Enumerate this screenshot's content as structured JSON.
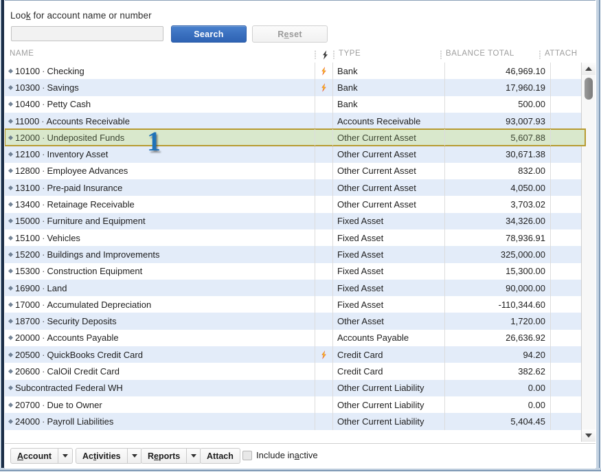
{
  "search": {
    "label_prefix": "Loo",
    "label_accel": "k",
    "label_suffix": " for account name or number",
    "label_full": "Look for account name or number",
    "input_value": "",
    "input_placeholder": "",
    "search_button": "Search",
    "reset_button": "Reset",
    "search_button_color": "#3a70bf"
  },
  "table": {
    "columns": [
      {
        "key": "name",
        "label": "NAME"
      },
      {
        "key": "bolt",
        "label": "⚡"
      },
      {
        "key": "type",
        "label": "TYPE"
      },
      {
        "key": "balance",
        "label": "BALANCE TOTAL"
      },
      {
        "key": "attach",
        "label": "ATTACH"
      }
    ],
    "selected_row_index": 4,
    "selection_color": "#d9e8cc",
    "selection_border_color": "#b79a30",
    "alt_row_color": "#e3ecf9",
    "rows": [
      {
        "number": "10100",
        "name": "Checking",
        "bolt": true,
        "type": "Bank",
        "balance": "46,969.10",
        "attach": ""
      },
      {
        "number": "10300",
        "name": "Savings",
        "bolt": true,
        "type": "Bank",
        "balance": "17,960.19",
        "attach": ""
      },
      {
        "number": "10400",
        "name": "Petty Cash",
        "bolt": false,
        "type": "Bank",
        "balance": "500.00",
        "attach": ""
      },
      {
        "number": "11000",
        "name": "Accounts Receivable",
        "bolt": false,
        "type": "Accounts Receivable",
        "balance": "93,007.93",
        "attach": ""
      },
      {
        "number": "12000",
        "name": "Undeposited Funds",
        "bolt": false,
        "type": "Other Current Asset",
        "balance": "5,607.88",
        "attach": ""
      },
      {
        "number": "12100",
        "name": "Inventory Asset",
        "bolt": false,
        "type": "Other Current Asset",
        "balance": "30,671.38",
        "attach": ""
      },
      {
        "number": "12800",
        "name": "Employee Advances",
        "bolt": false,
        "type": "Other Current Asset",
        "balance": "832.00",
        "attach": ""
      },
      {
        "number": "13100",
        "name": "Pre-paid Insurance",
        "bolt": false,
        "type": "Other Current Asset",
        "balance": "4,050.00",
        "attach": ""
      },
      {
        "number": "13400",
        "name": "Retainage Receivable",
        "bolt": false,
        "type": "Other Current Asset",
        "balance": "3,703.02",
        "attach": ""
      },
      {
        "number": "15000",
        "name": "Furniture and Equipment",
        "bolt": false,
        "type": "Fixed Asset",
        "balance": "34,326.00",
        "attach": ""
      },
      {
        "number": "15100",
        "name": "Vehicles",
        "bolt": false,
        "type": "Fixed Asset",
        "balance": "78,936.91",
        "attach": ""
      },
      {
        "number": "15200",
        "name": "Buildings and Improvements",
        "bolt": false,
        "type": "Fixed Asset",
        "balance": "325,000.00",
        "attach": ""
      },
      {
        "number": "15300",
        "name": "Construction Equipment",
        "bolt": false,
        "type": "Fixed Asset",
        "balance": "15,300.00",
        "attach": ""
      },
      {
        "number": "16900",
        "name": "Land",
        "bolt": false,
        "type": "Fixed Asset",
        "balance": "90,000.00",
        "attach": ""
      },
      {
        "number": "17000",
        "name": "Accumulated Depreciation",
        "bolt": false,
        "type": "Fixed Asset",
        "balance": "-110,344.60",
        "attach": ""
      },
      {
        "number": "18700",
        "name": "Security Deposits",
        "bolt": false,
        "type": "Other Asset",
        "balance": "1,720.00",
        "attach": ""
      },
      {
        "number": "20000",
        "name": "Accounts Payable",
        "bolt": false,
        "type": "Accounts Payable",
        "balance": "26,636.92",
        "attach": ""
      },
      {
        "number": "20500",
        "name": "QuickBooks Credit Card",
        "bolt": true,
        "type": "Credit Card",
        "balance": "94.20",
        "attach": ""
      },
      {
        "number": "20600",
        "name": "CalOil Credit Card",
        "bolt": false,
        "type": "Credit Card",
        "balance": "382.62",
        "attach": ""
      },
      {
        "number": "",
        "name": "Subcontracted Federal WH",
        "bolt": false,
        "type": "Other Current Liability",
        "balance": "0.00",
        "attach": ""
      },
      {
        "number": "20700",
        "name": "Due to Owner",
        "bolt": false,
        "type": "Other Current Liability",
        "balance": "0.00",
        "attach": ""
      },
      {
        "number": "24000",
        "name": "Payroll Liabilities",
        "bolt": false,
        "type": "Other Current Liability",
        "balance": "5,404.45",
        "attach": ""
      }
    ]
  },
  "toolbar": {
    "account_label": "Account",
    "account_accel": "A",
    "activities_label": "Activities",
    "activities_accel": "t",
    "reports_label": "Reports",
    "reports_accel": "e",
    "attach_label": "Attach",
    "include_inactive_label": "Include inactive",
    "include_inactive_checked": false
  },
  "annotations": [
    {
      "id": "1",
      "label": "1",
      "color": "#1f72b8",
      "target": "row-12000-undeposited-funds"
    }
  ]
}
